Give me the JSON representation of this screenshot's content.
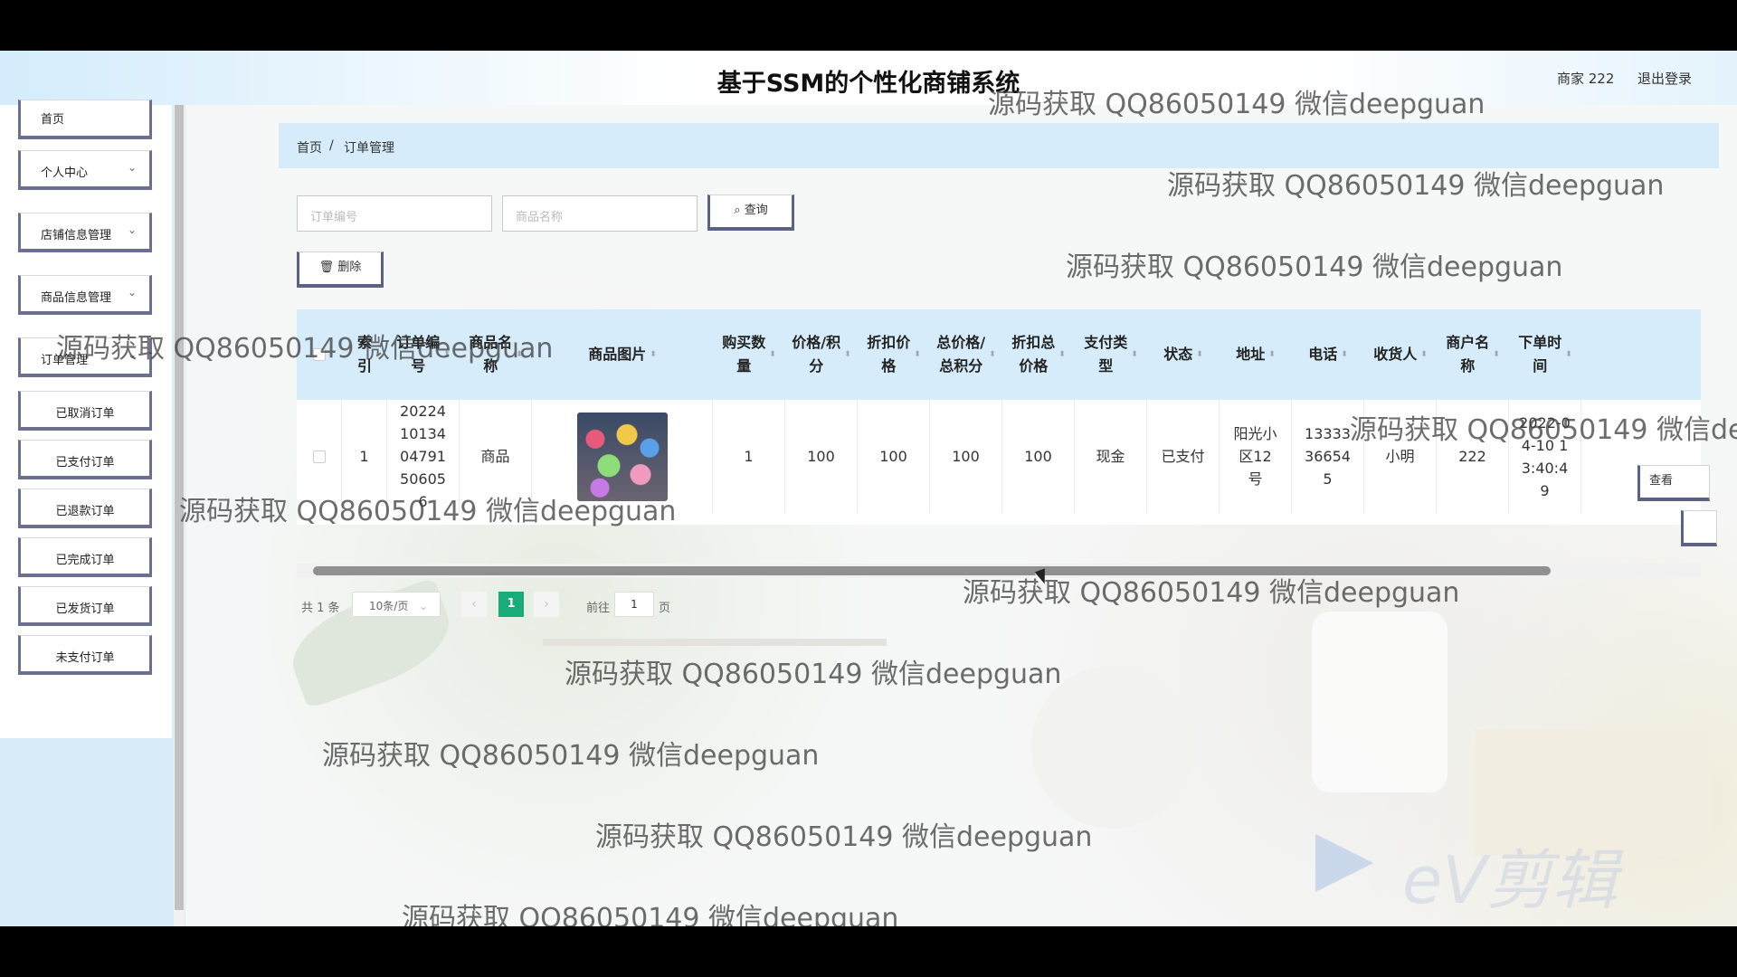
{
  "header": {
    "title": "基于SSM的个性化商铺系统",
    "user_label": "商家 222",
    "logout_label": "退出登录"
  },
  "sidebar": {
    "items": [
      {
        "label": "首页"
      },
      {
        "label": "个人中心",
        "chevron": "⌄"
      },
      {
        "label": "店铺信息管理",
        "chevron": "⌄"
      },
      {
        "label": "商品信息管理",
        "chevron": "⌄"
      },
      {
        "label": "订单管理",
        "chevron": "⌄"
      }
    ],
    "sub_items": [
      {
        "label": "已取消订单"
      },
      {
        "label": "已支付订单"
      },
      {
        "label": "已退款订单"
      },
      {
        "label": "已完成订单"
      },
      {
        "label": "已发货订单"
      },
      {
        "label": "未支付订单"
      }
    ]
  },
  "breadcrumb": {
    "home": "首页",
    "sep": "/",
    "current": "订单管理"
  },
  "search": {
    "order_no_placeholder": "订单编号",
    "goods_name_placeholder": "商品名称",
    "query_label": "查询",
    "query_icon": "search-icon"
  },
  "toolbar": {
    "delete_label": "删除",
    "delete_icon": "trash-icon"
  },
  "table": {
    "columns": [
      {
        "label": "索\n引"
      },
      {
        "label": "订单编\n号"
      },
      {
        "label": "商品名\n称"
      },
      {
        "label": "商品图片"
      },
      {
        "label": "购买数\n量"
      },
      {
        "label": "价格/积\n分"
      },
      {
        "label": "折扣价\n格"
      },
      {
        "label": "总价格/\n总积分"
      },
      {
        "label": "折扣总\n价格"
      },
      {
        "label": "支付类\n型"
      },
      {
        "label": "状态"
      },
      {
        "label": "地址"
      },
      {
        "label": "电话"
      },
      {
        "label": "收货人"
      },
      {
        "label": "商户名\n称"
      },
      {
        "label": "下单时\n间"
      }
    ],
    "rows": [
      {
        "index": "1",
        "order_no": "202241013404791506056",
        "goods_name": "商品",
        "quantity": "1",
        "price": "100",
        "discount_price": "100",
        "total": "100",
        "discount_total": "100",
        "pay_type": "现金",
        "status": "已支付",
        "address": "阳光小区12号",
        "phone": "13333366545",
        "receiver": "小明",
        "merchant": "222",
        "order_time": "2022-04-10 13:40:49"
      }
    ],
    "row_action_label": "查看"
  },
  "pagination": {
    "total_label": "共 1 条",
    "page_size": "10条/页",
    "prev": "‹",
    "current": "1",
    "next": "›",
    "goto_label": "前往",
    "goto_value": "1",
    "page_suffix": "页"
  },
  "watermark": {
    "text": "源码获取 QQ86050149 微信deepguan",
    "ev_brand": "eV剪辑"
  }
}
